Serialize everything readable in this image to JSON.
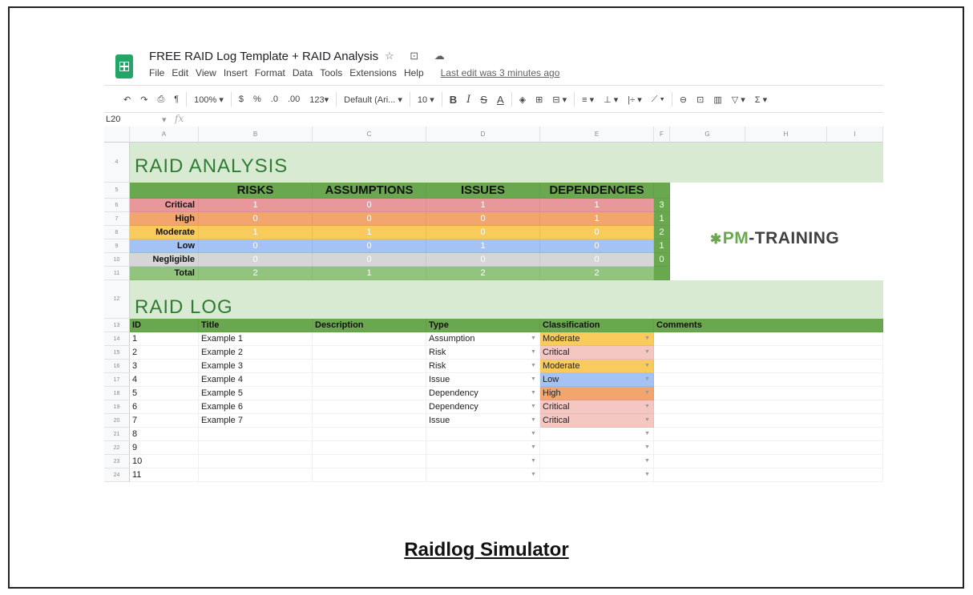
{
  "doc": {
    "title": "FREE RAID Log Template + RAID Analysis",
    "title_icons": "☆ ⊡ ☁",
    "menu": [
      "File",
      "Edit",
      "View",
      "Insert",
      "Format",
      "Data",
      "Tools",
      "Extensions",
      "Help"
    ],
    "last_edit": "Last edit was 3 minutes ago"
  },
  "toolbar": {
    "undo": "↶",
    "redo": "↷",
    "print": "⎙",
    "paint_format": "¶",
    "zoom": "100% ▾",
    "currency": "$",
    "percent": "%",
    "dec_less": ".0",
    "dec_more": ".00",
    "format_more": "123▾",
    "font": "Default (Ari... ▾",
    "font_size": "10 ▾",
    "bold": "B",
    "italic": "I",
    "strike": "S",
    "text_color": "A",
    "fill": "◈",
    "borders": "⊞",
    "merge": "⊟ ▾",
    "halign": "≡ ▾",
    "valign": "⊥ ▾",
    "wrap": "|÷ ▾",
    "rotate": "⟋ ▾",
    "link": "⊖",
    "comment": "⊡",
    "chart": "▥",
    "filter": "▽ ▾",
    "functions": "Σ ▾"
  },
  "formula_bar": {
    "cell_ref": "L20",
    "dropdown": "▾",
    "fx": "fx"
  },
  "columns": [
    "A",
    "B",
    "C",
    "D",
    "E",
    "F",
    "G",
    "H",
    "I"
  ],
  "rows": {
    "analysis_title_row": "4",
    "header_row": "5",
    "analysis_rows": [
      "6",
      "7",
      "8",
      "9",
      "10",
      "11"
    ],
    "log_title_row": "12",
    "log_header_row": "13",
    "log_rows": [
      "14",
      "15",
      "16",
      "17",
      "18",
      "19",
      "20",
      "21",
      "22",
      "23",
      "24"
    ]
  },
  "analysis": {
    "title": "RAID  ANALYSIS",
    "headers": [
      "RISKS",
      "ASSUMPTIONS",
      "ISSUES",
      "DEPENDENCIES"
    ],
    "rows": [
      {
        "label": "Critical",
        "values": [
          "1",
          "0",
          "1",
          "1"
        ],
        "total": "3",
        "color": "#e8989a"
      },
      {
        "label": "High",
        "values": [
          "0",
          "0",
          "0",
          "1"
        ],
        "total": "1",
        "color": "#f2a66e"
      },
      {
        "label": "Moderate",
        "values": [
          "1",
          "1",
          "0",
          "0"
        ],
        "total": "2",
        "color": "#f9cb5c"
      },
      {
        "label": "Low",
        "values": [
          "0",
          "0",
          "1",
          "0"
        ],
        "total": "1",
        "color": "#a4c2f4"
      },
      {
        "label": "Negligible",
        "values": [
          "0",
          "0",
          "0",
          "0"
        ],
        "total": "0",
        "color": "#d6d6d6"
      },
      {
        "label": "Total",
        "values": [
          "2",
          "1",
          "2",
          "2"
        ],
        "total": "",
        "color": "#93c47d"
      }
    ]
  },
  "log": {
    "title": "RAID  LOG",
    "headers": [
      "ID",
      "Title",
      "Description",
      "Type",
      "Classification",
      "Comments"
    ],
    "rows": [
      {
        "id": "1",
        "title": "Example 1",
        "type": "Assumption",
        "class": "Moderate",
        "class_color": "#f9cb5c"
      },
      {
        "id": "2",
        "title": "Example 2",
        "type": "Risk",
        "class": "Critical",
        "class_color": "#f4c7c3"
      },
      {
        "id": "3",
        "title": "Example 3",
        "type": "Risk",
        "class": "Moderate",
        "class_color": "#f9cb5c"
      },
      {
        "id": "4",
        "title": "Example 4",
        "type": "Issue",
        "class": "Low",
        "class_color": "#a4c2f4"
      },
      {
        "id": "5",
        "title": "Example 5",
        "type": "Dependency",
        "class": "High",
        "class_color": "#f2a66e"
      },
      {
        "id": "6",
        "title": "Example 6",
        "type": "Dependency",
        "class": "Critical",
        "class_color": "#f4c7c3"
      },
      {
        "id": "7",
        "title": "Example 7",
        "type": "Issue",
        "class": "Critical",
        "class_color": "#f4c7c3"
      },
      {
        "id": "8",
        "title": "",
        "type": "",
        "class": "",
        "class_color": "#ffffff"
      },
      {
        "id": "9",
        "title": "",
        "type": "",
        "class": "",
        "class_color": "#ffffff"
      },
      {
        "id": "10",
        "title": "",
        "type": "",
        "class": "",
        "class_color": "#ffffff"
      },
      {
        "id": "11",
        "title": "",
        "type": "",
        "class": "",
        "class_color": "#ffffff"
      }
    ]
  },
  "brand": {
    "figure": "✱",
    "pm": "PM",
    "rest": "-TRAINING"
  },
  "caption": "Raidlog Simulator"
}
